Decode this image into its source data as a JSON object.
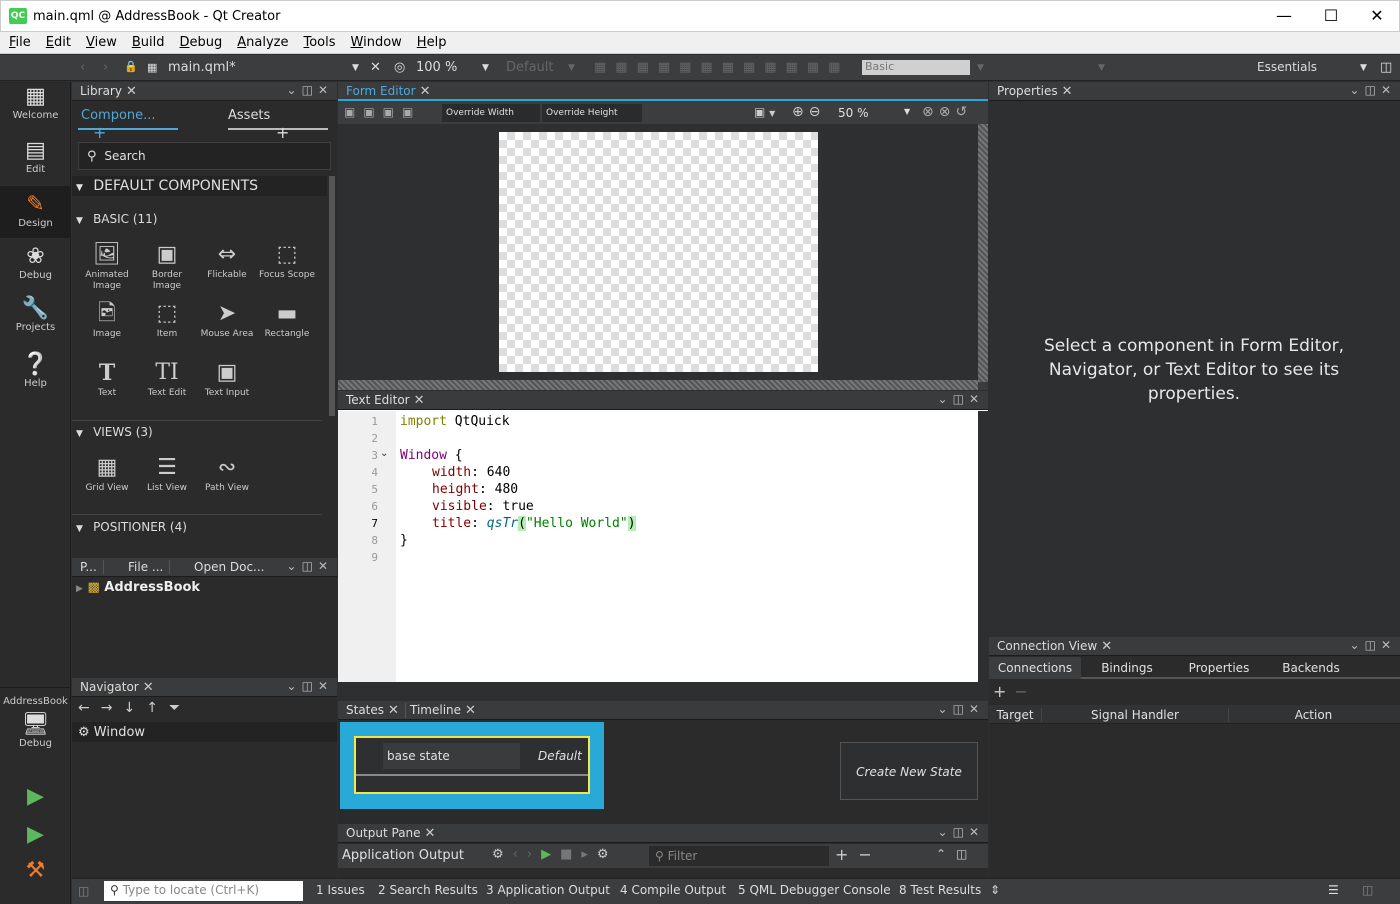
{
  "window": {
    "title": "main.qml @ AddressBook - Qt Creator",
    "icon": "QC"
  },
  "menu": [
    "File",
    "Edit",
    "View",
    "Build",
    "Debug",
    "Analyze",
    "Tools",
    "Window",
    "Help"
  ],
  "toolbar": {
    "file": "main.qml*",
    "zoom": "100 %",
    "state": "Default",
    "style": "Basic",
    "workspace": "Essentials"
  },
  "modes": [
    {
      "label": "Welcome",
      "icon": "grid-icon"
    },
    {
      "label": "Edit",
      "icon": "document-icon"
    },
    {
      "label": "Design",
      "icon": "pencil-icon"
    },
    {
      "label": "Debug",
      "icon": "bug-icon"
    },
    {
      "label": "Projects",
      "icon": "wrench-icon"
    },
    {
      "label": "Help",
      "icon": "help-icon"
    }
  ],
  "kit": {
    "project": "AddressBook",
    "config": "Debug"
  },
  "library": {
    "title": "Library",
    "tab_components": "Compone...",
    "tab_assets": "Assets",
    "search": "Search",
    "section": "DEFAULT COMPONENTS",
    "groups": [
      {
        "label": "BASIC (11)",
        "items": [
          "Animated Image",
          "Border Image",
          "Flickable",
          "Focus Scope",
          "Image",
          "Item",
          "Mouse Area",
          "Rectangle",
          "Text",
          "Text Edit",
          "Text Input"
        ]
      },
      {
        "label": "VIEWS (3)",
        "items": [
          "Grid View",
          "List View",
          "Path View"
        ]
      },
      {
        "label": "POSITIONER (4)",
        "items": []
      }
    ]
  },
  "projects": {
    "tabs": [
      "P...",
      "File ...",
      "Open Doc..."
    ],
    "root": "AddressBook"
  },
  "navigator": {
    "title": "Navigator",
    "root": "Window"
  },
  "form_editor": {
    "title": "Form Editor",
    "override_width": "Override Width",
    "override_height": "Override Height",
    "zoom": "50 %"
  },
  "text_editor": {
    "title": "Text Editor",
    "line_numbers": [
      "1",
      "2",
      "3",
      "4",
      "5",
      "6",
      "7",
      "8",
      "9"
    ]
  },
  "code": {
    "l1_kw": "import",
    "l1_rest": " QtQuick",
    "l3": "Window",
    "l3b": " {",
    "w_prop": "width",
    "w_val": "640",
    "h_prop": "height",
    "h_val": "480",
    "v_prop": "visible",
    "v_val": "true",
    "t_prop": "title",
    "t_fn": "qsTr",
    "t_str": "\"Hello World\"",
    "close": "}"
  },
  "states": {
    "tab_states": "States",
    "tab_timeline": "Timeline",
    "base_state": "base state",
    "default": "Default",
    "create": "Create New State"
  },
  "output": {
    "title": "Output Pane",
    "subtitle": "Application Output",
    "filter": "Filter"
  },
  "properties": {
    "title": "Properties",
    "hint": "Select a component in Form Editor, Navigator, or Text Editor to see its properties."
  },
  "connections": {
    "title": "Connection View",
    "tabs": [
      "Connections",
      "Bindings",
      "Properties",
      "Backends"
    ],
    "columns": [
      "Target",
      "Signal Handler",
      "Action"
    ]
  },
  "statusbar": {
    "locate": "Type to locate (Ctrl+K)",
    "items": [
      "1  Issues",
      "2  Search Results",
      "3  Application Output",
      "4  Compile Output",
      "5  QML Debugger Console",
      "8  Test Results"
    ]
  },
  "colors": {
    "accent": "#4ea8d8",
    "state_bg": "#29a9d7",
    "state_border": "#f0e64a",
    "keyword": "#808000",
    "type": "#800080",
    "string": "#008000"
  }
}
